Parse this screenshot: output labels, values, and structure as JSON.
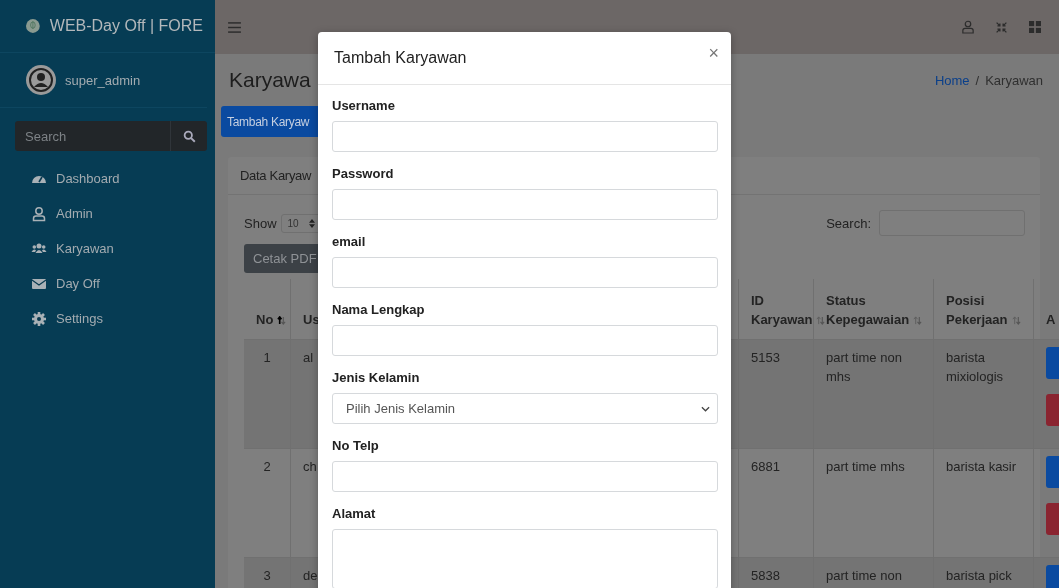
{
  "sidebar": {
    "brand": "WEB-Day Off | FORE",
    "user": "super_admin",
    "search": {
      "placeholder": "Search"
    },
    "items": [
      {
        "label": "Dashboard"
      },
      {
        "label": "Admin"
      },
      {
        "label": "Karyawan"
      },
      {
        "label": "Day Off"
      },
      {
        "label": "Settings"
      }
    ]
  },
  "content": {
    "title": "Karyawa",
    "breadcrumb_separator": "/",
    "breadcrumb": [
      {
        "label": "Home",
        "link": true
      },
      {
        "label": "Karyawan",
        "link": false
      }
    ],
    "add_button": "Tambah Karyaw",
    "card": {
      "title": "Data Karyaw",
      "show_label": "Show",
      "page_size": "10",
      "print_button": "Cetak PDF",
      "search_label": "Search:",
      "columns": [
        {
          "label": "No",
          "sorted": true
        },
        {
          "label": "Us"
        },
        {
          "label": "ID Karyawan",
          "sorted": false
        },
        {
          "label": "Status Kepegawaian",
          "sorted": false
        },
        {
          "label": "Posisi Pekerjaan",
          "sorted": false
        },
        {
          "label": "A"
        }
      ],
      "rows": [
        {
          "no": "1",
          "username": "al",
          "id": "5153",
          "status": "part time non mhs",
          "position": "barista mixiologis"
        },
        {
          "no": "2",
          "username": "ch",
          "id": "6881",
          "status": "part time mhs",
          "position": "barista kasir"
        },
        {
          "no": "3",
          "username": "de",
          "id": "5838",
          "status": "part time non",
          "position": "barista pick"
        }
      ]
    }
  },
  "modal": {
    "title": "Tambah Karyawan",
    "close": "×",
    "fields": [
      {
        "label": "Username",
        "kind": "input"
      },
      {
        "label": "Password",
        "kind": "input"
      },
      {
        "label": "email",
        "kind": "input"
      },
      {
        "label": "Nama Lengkap",
        "kind": "input"
      },
      {
        "label": "Jenis Kelamin",
        "kind": "select",
        "value": "Pilih Jenis Kelamin"
      },
      {
        "label": "No Telp",
        "kind": "input"
      },
      {
        "label": "Alamat",
        "kind": "textarea"
      }
    ]
  }
}
